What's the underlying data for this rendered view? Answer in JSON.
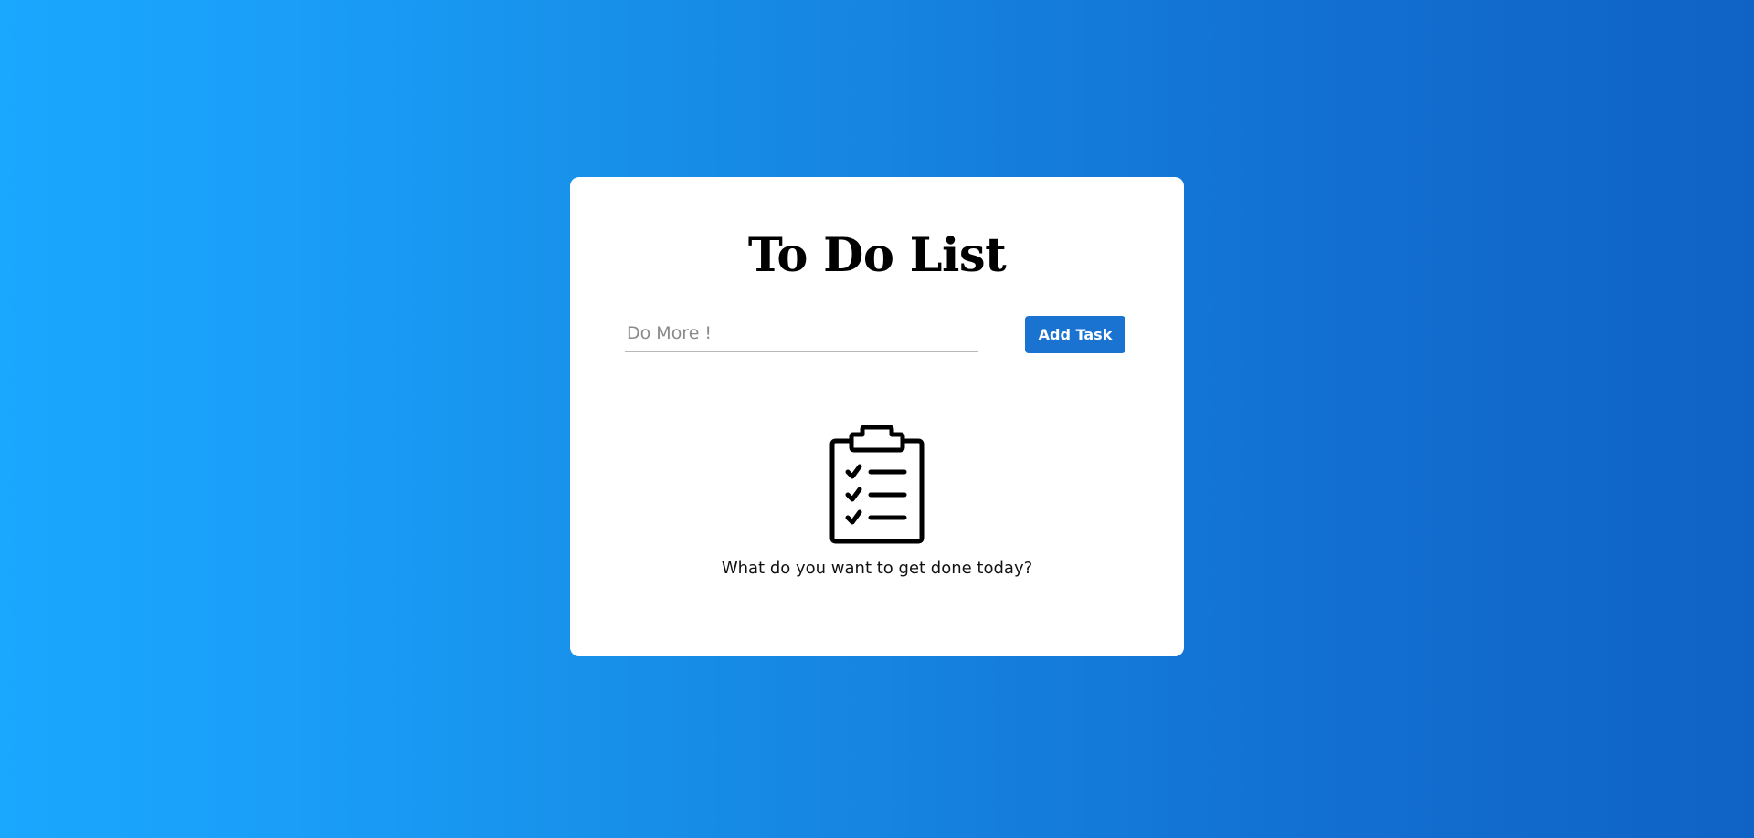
{
  "app": {
    "title": "To Do List"
  },
  "task_form": {
    "input_value": "",
    "input_placeholder": "Do More !",
    "add_button_label": "Add Task"
  },
  "empty_state": {
    "icon": "clipboard-checklist-icon",
    "message": "What do you want to get done today?"
  },
  "colors": {
    "background_gradient_start": "#1aa7fe",
    "background_gradient_end": "#0f63c5",
    "card": "#ffffff",
    "button": "#1a73d1",
    "button_text": "#ffffff"
  }
}
